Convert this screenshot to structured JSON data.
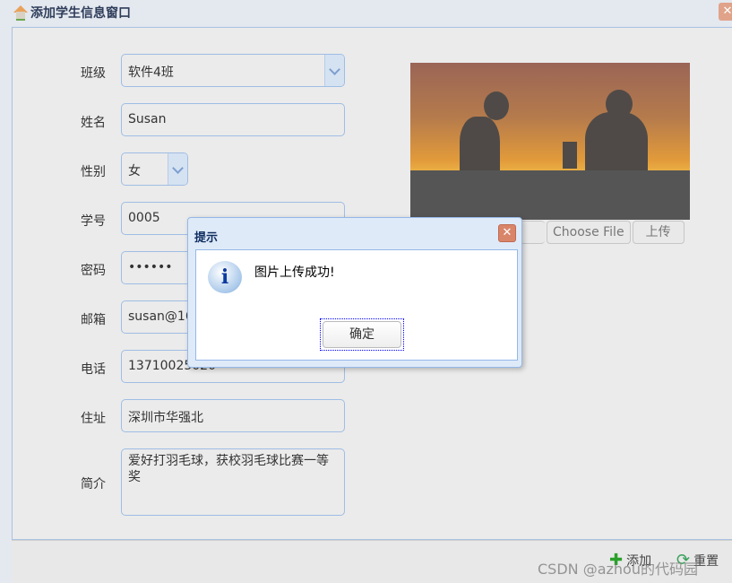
{
  "window": {
    "title": "添加学生信息窗口",
    "close": "✕"
  },
  "form": {
    "class_label": "班级",
    "class_value": "软件4班",
    "name_label": "姓名",
    "name_value": "Susan",
    "gender_label": "性别",
    "gender_value": "女",
    "id_label": "学号",
    "id_value": "0005",
    "password_label": "密码",
    "password_value": "••••••",
    "email_label": "邮箱",
    "email_value": "susan@16",
    "phone_label": "电话",
    "phone_value": "13710025020",
    "address_label": "住址",
    "address_value": "深圳市华强北",
    "intro_label": "简介",
    "intro_value": "爱好打羽毛球，获校羽毛球比赛一等奖"
  },
  "upload": {
    "choose_file": "Choose File",
    "upload": "上传"
  },
  "footer": {
    "add": "添加",
    "reset": "重置"
  },
  "dialog": {
    "title": "提示",
    "close": "✕",
    "icon": "i",
    "message": "图片上传成功!",
    "ok": "确定"
  },
  "watermark": "CSDN @azhou的代码园"
}
